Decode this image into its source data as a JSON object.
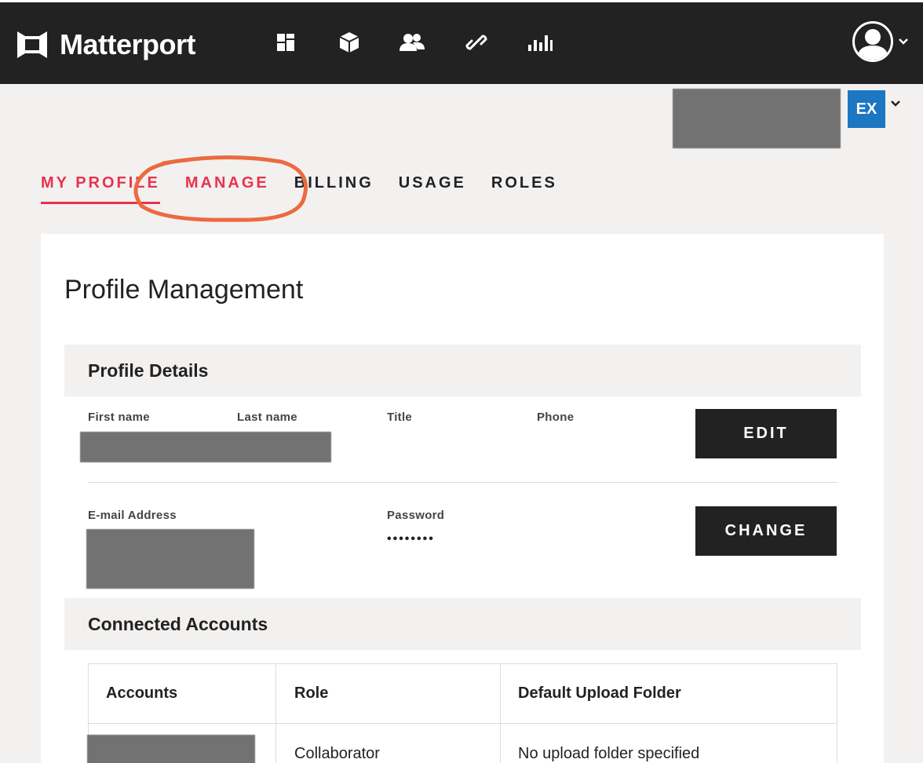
{
  "brand": {
    "name": "Matterport"
  },
  "topnav": {
    "icons": [
      "dashboard-icon",
      "3d-cube-icon",
      "users-icon",
      "link-icon",
      "bar-chart-icon"
    ]
  },
  "org_badge": {
    "initials": "EX"
  },
  "tabs": [
    {
      "label": "MY PROFILE",
      "active": true
    },
    {
      "label": "MANAGE",
      "active": false
    },
    {
      "label": "BILLING",
      "active": false
    },
    {
      "label": "USAGE",
      "active": false
    },
    {
      "label": "ROLES",
      "active": false
    }
  ],
  "page": {
    "title": "Profile Management"
  },
  "profile_details": {
    "heading": "Profile Details",
    "labels": {
      "first_name": "First name",
      "last_name": "Last name",
      "title": "Title",
      "phone": "Phone",
      "email": "E-mail Address",
      "password": "Password"
    },
    "password_value": "••••••••",
    "edit_label": "EDIT",
    "change_label": "CHANGE"
  },
  "connected_accounts": {
    "heading": "Connected Accounts",
    "columns": [
      "Accounts",
      "Role",
      "Default Upload Folder"
    ],
    "rows": [
      {
        "role": "Collaborator",
        "folder": "No upload folder specified"
      }
    ]
  },
  "colors": {
    "topbar": "#222222",
    "accent": "#e8324e",
    "badge": "#1c77c3",
    "annotation": "#ec6a3f",
    "redaction": "#737273"
  }
}
